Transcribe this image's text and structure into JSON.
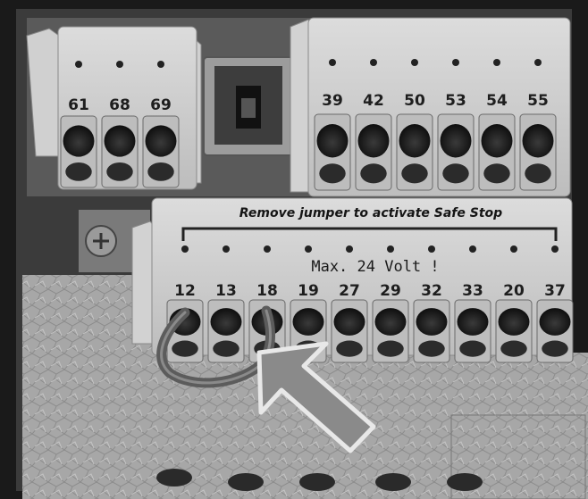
{
  "top_left_block": {
    "terminals": [
      "61",
      "68",
      "69"
    ]
  },
  "top_right_block": {
    "terminals": [
      "39",
      "42",
      "50",
      "53",
      "54",
      "55"
    ]
  },
  "control_block": {
    "banner": "Remove jumper to activate Safe Stop",
    "voltage_label": "Max. 24 Volt !",
    "terminals": [
      "12",
      "13",
      "18",
      "19",
      "27",
      "29",
      "32",
      "33",
      "20",
      "37"
    ]
  },
  "annotations": {
    "arrow_target": "jumper wire between terminals 12 and 18"
  },
  "colors": {
    "terminal_body": "#cfcfcf",
    "housing": "#2a2a2a",
    "galvanized_plate": "#a9a9a9",
    "arrow_fill": "#8a8a8a"
  }
}
